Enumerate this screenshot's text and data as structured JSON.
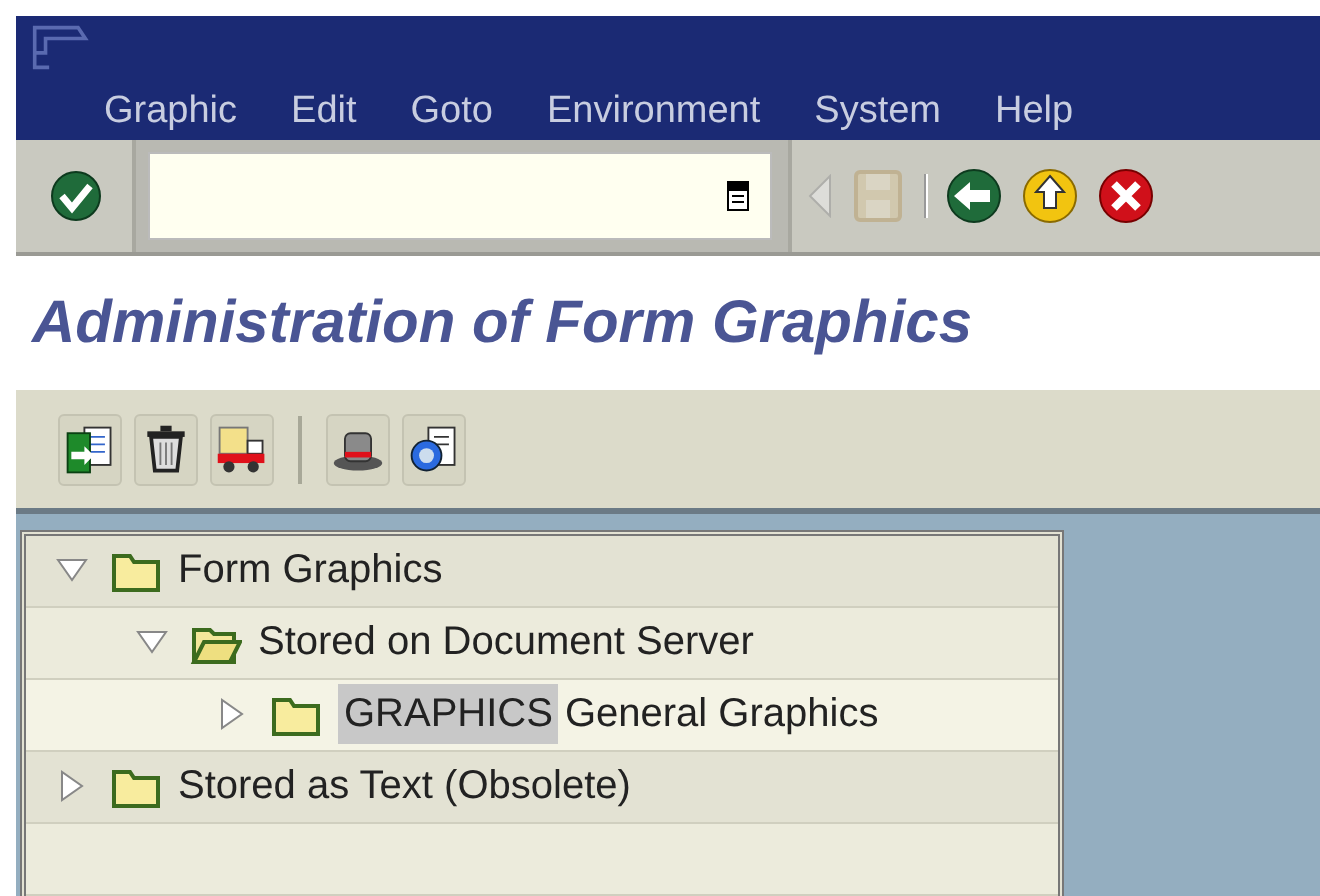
{
  "menu": [
    {
      "label": "Graphic"
    },
    {
      "label": "Edit"
    },
    {
      "label": "Goto"
    },
    {
      "label": "Environment"
    },
    {
      "label": "System"
    },
    {
      "label": "Help"
    }
  ],
  "toolbar": {
    "buttons": [
      {
        "kind": "back-triangle",
        "disabled": true
      },
      {
        "kind": "save",
        "disabled": true
      },
      {
        "kind": "separator"
      },
      {
        "kind": "back",
        "disabled": false
      },
      {
        "kind": "exit",
        "disabled": false
      },
      {
        "kind": "cancel",
        "disabled": false
      }
    ]
  },
  "title": "Administration of Form Graphics",
  "app_toolbar": [
    {
      "kind": "copy"
    },
    {
      "kind": "delete"
    },
    {
      "kind": "transport"
    },
    {
      "kind": "separator"
    },
    {
      "kind": "hat"
    },
    {
      "kind": "info"
    }
  ],
  "tree": [
    {
      "label": "Form Graphics",
      "expanded": true,
      "folder_open": false,
      "children": [
        {
          "label": "Stored on Document Server",
          "expanded": true,
          "folder_open": true,
          "children": [
            {
              "key": "GRAPHICS",
              "label": "General Graphics",
              "expanded": false,
              "folder_open": false
            }
          ]
        }
      ]
    },
    {
      "label": "Stored as Text (Obsolete)",
      "expanded": false,
      "folder_open": false
    }
  ]
}
